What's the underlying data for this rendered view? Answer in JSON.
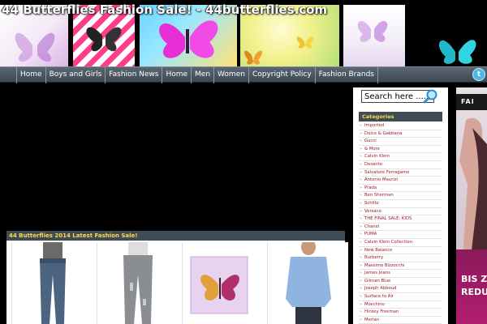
{
  "header": {
    "site_title": "44 Butterflies Fashion Sale! - 44butterflies.com"
  },
  "nav": {
    "items": [
      "Home",
      "Boys and Girls",
      "Fashion News",
      "Home",
      "Men",
      "Women",
      "Copyright Policy",
      "Fashion Brands"
    ]
  },
  "social": {
    "twitter_icon": "twitter-icon",
    "twitter_glyph": "t"
  },
  "main": {
    "section_title": "44 Butterflies 2014 Latest Fashion Sale!",
    "products": [
      {
        "icon": "jeans-product-image"
      },
      {
        "icon": "distressed-jeans-product-image"
      },
      {
        "icon": "butterfly-canvas-product-image"
      },
      {
        "icon": "shirt-model-product-image"
      }
    ]
  },
  "sidebar": {
    "search_placeholder": "Search here ....",
    "categories_title": "Categories",
    "categories": [
      "Imported",
      "Dolce & Gabbana",
      "Gucci",
      "& More",
      "Calvin Klein",
      "Desanto",
      "Salvatore Ferragamo",
      "Antonio Maurizi",
      "Prada",
      "Ben Sherman",
      "Schiltz",
      "Versace",
      "THE FINAL SALE: KIDS",
      "Chanel",
      "PUMA",
      "Calvin Klein Collection",
      "New Balance",
      "Burberry",
      "Massimo Bizzocchi",
      "James Jeans",
      "Gilman Blue",
      "Joseph Abboud",
      "Surface to Air",
      "Moschino",
      "Hickey Freeman",
      "Merlan"
    ]
  },
  "ad": {
    "top_text": "FAI",
    "line1": "BIS Z",
    "line2": "REDU"
  },
  "colors": {
    "nav_bg": "#4a5661",
    "heading_bg": "#3f4b55",
    "heading_text": "#ffd94a",
    "category_text": "#a0142a",
    "twitter": "#4fb6e8"
  }
}
